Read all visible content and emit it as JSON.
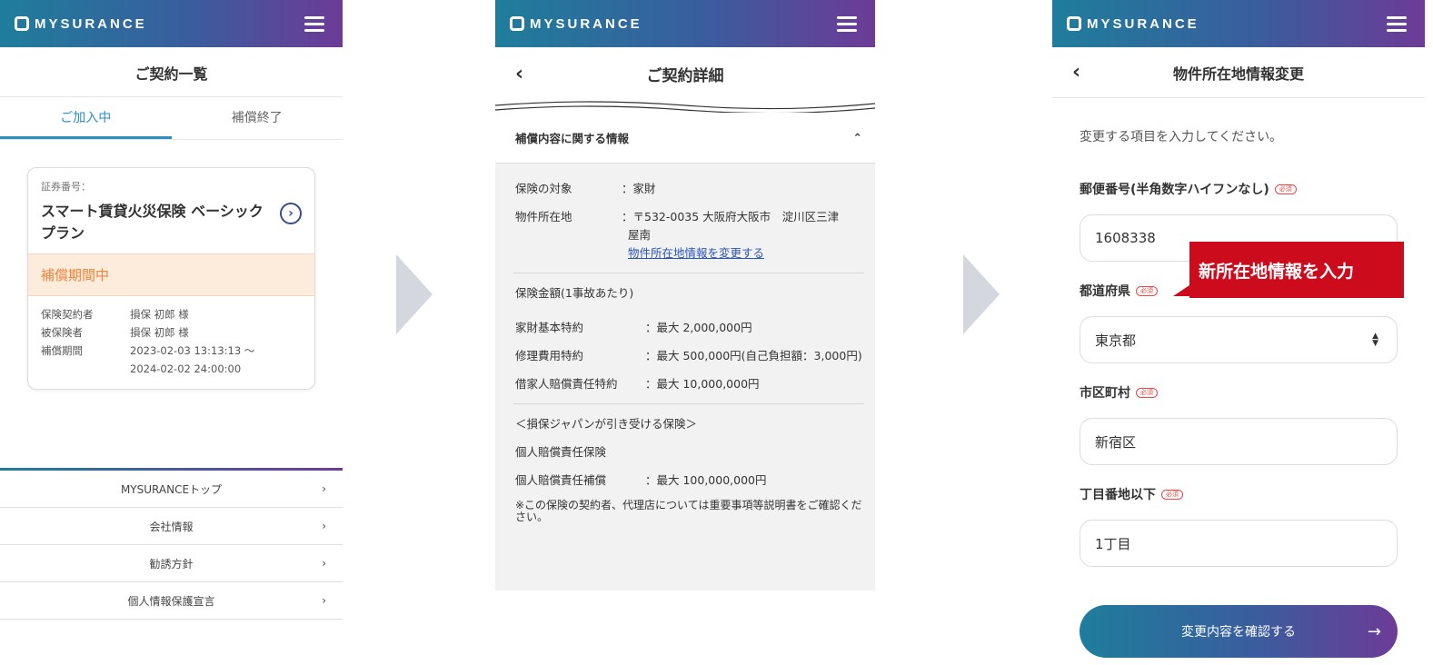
{
  "brand": "MYSURANCE",
  "screen1": {
    "title": "ご契約一覧",
    "tabs": [
      "ご加入中",
      "補償終了"
    ],
    "card": {
      "cert_label": "証券番号：",
      "plan_name": "スマート賃貸火災保険 ベーシックプラン",
      "status": "補償期間中",
      "rows": [
        {
          "k": "保険契約者",
          "v": "損保 初郎 様"
        },
        {
          "k": "被保険者",
          "v": "損保 初郎 様"
        },
        {
          "k": "補償期間",
          "v": "2023-02-03 13:13:13 ～"
        },
        {
          "k": "",
          "v": "2024-02-02 24:00:00"
        }
      ]
    },
    "footer": [
      "MYSURANCEトップ",
      "会社情報",
      "勧誘方針",
      "個人情報保護宣言"
    ]
  },
  "screen2": {
    "title": "ご契約詳細",
    "section": "補償内容に関する情報",
    "target_k": "保険の対象",
    "target_v": "：家財",
    "loc_k": "物件所在地",
    "loc_v1": "：〒532-0035 大阪府大阪市　淀川区三津",
    "loc_v2": "屋南",
    "loc_link": "物件所在地情報を変更する",
    "amount_title": "保険金額(1事故あたり)",
    "amounts": [
      {
        "k": "家財基本特約",
        "v": "：最大 2,000,000円"
      },
      {
        "k": "修理費用特約",
        "v": "：最大 500,000円(自己負担額：3,000円)"
      },
      {
        "k": "借家人賠償責任特約",
        "v": "：最大 10,000,000円"
      }
    ],
    "sompo_title": "＜損保ジャパンが引き受ける保険＞",
    "personal_title": "個人賠償責任保険",
    "personal_k": "個人賠償責任補償",
    "personal_v": "：最大 100,000,000円",
    "note": "※この保険の契約者、代理店については重要事項等説明書をご確認ください。"
  },
  "screen3": {
    "title": "物件所在地情報変更",
    "intro": "変更する項目を入力してください。",
    "required": "必須",
    "fields": [
      {
        "label": "郵便番号(半角数字ハイフンなし)",
        "value": "1608338"
      },
      {
        "label": "都道府県",
        "value": "東京都"
      },
      {
        "label": "市区町村",
        "value": "新宿区"
      },
      {
        "label": "丁目番地以下",
        "value": "1丁目"
      }
    ],
    "callout": "新所在地情報を入力",
    "submit": "変更内容を確認する"
  }
}
